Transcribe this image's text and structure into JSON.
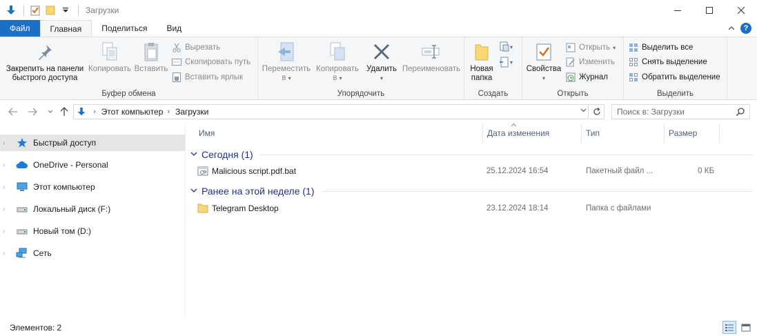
{
  "window": {
    "title": "Загрузки"
  },
  "tabs": {
    "file": "Файл",
    "home": "Главная",
    "share": "Поделиться",
    "view": "Вид"
  },
  "ribbon": {
    "clipboard": {
      "label": "Буфер обмена",
      "pin_line1": "Закрепить на панели",
      "pin_line2": "быстрого доступа",
      "copy": "Копировать",
      "paste": "Вставить",
      "cut": "Вырезать",
      "copy_path": "Скопировать путь",
      "paste_shortcut": "Вставить ярлык"
    },
    "organize": {
      "label": "Упорядочить",
      "move_line1": "Переместить",
      "move_line2": "в",
      "copyto_line1": "Копировать",
      "copyto_line2": "в",
      "delete": "Удалить",
      "rename": "Переименовать"
    },
    "new": {
      "label": "Создать",
      "folder_line1": "Новая",
      "folder_line2": "папка"
    },
    "open": {
      "label": "Открыть",
      "properties": "Свойства",
      "open": "Открыть",
      "edit": "Изменить",
      "history": "Журнал"
    },
    "select": {
      "label": "Выделить",
      "select_all": "Выделить все",
      "select_none": "Снять выделение",
      "invert": "Обратить выделение"
    }
  },
  "address": {
    "crumbs": [
      "Этот компьютер",
      "Загрузки"
    ]
  },
  "search": {
    "placeholder": "Поиск в: Загрузки"
  },
  "navpane": {
    "items": [
      {
        "label": "Быстрый доступ",
        "icon": "star-icon",
        "selected": true
      },
      {
        "label": "OneDrive - Personal",
        "icon": "cloud-icon"
      },
      {
        "label": "Этот компьютер",
        "icon": "monitor-icon"
      },
      {
        "label": "Локальный диск (F:)",
        "icon": "drive-icon"
      },
      {
        "label": "Новый том (D:)",
        "icon": "drive-icon"
      },
      {
        "label": "Сеть",
        "icon": "network-icon"
      }
    ]
  },
  "columns": {
    "name": "Имя",
    "date": "Дата изменения",
    "type": "Тип",
    "size": "Размер"
  },
  "groups": [
    {
      "title": "Сегодня (1)",
      "files": [
        {
          "name": "Malicious script.pdf.bat",
          "date": "25.12.2024 16:54",
          "type": "Пакетный файл ...",
          "size": "0 КБ",
          "icon": "batch-file-icon"
        }
      ]
    },
    {
      "title": "Ранее на этой неделе (1)",
      "files": [
        {
          "name": "Telegram Desktop",
          "date": "23.12.2024 18:14",
          "type": "Папка с файлами",
          "size": "",
          "icon": "folder-icon"
        }
      ]
    }
  ],
  "status": {
    "count": "Элементов: 2"
  },
  "colors": {
    "accent": "#1a6fc9",
    "group_header": "#1e3287",
    "selected_nav": "#e5e5e5"
  }
}
